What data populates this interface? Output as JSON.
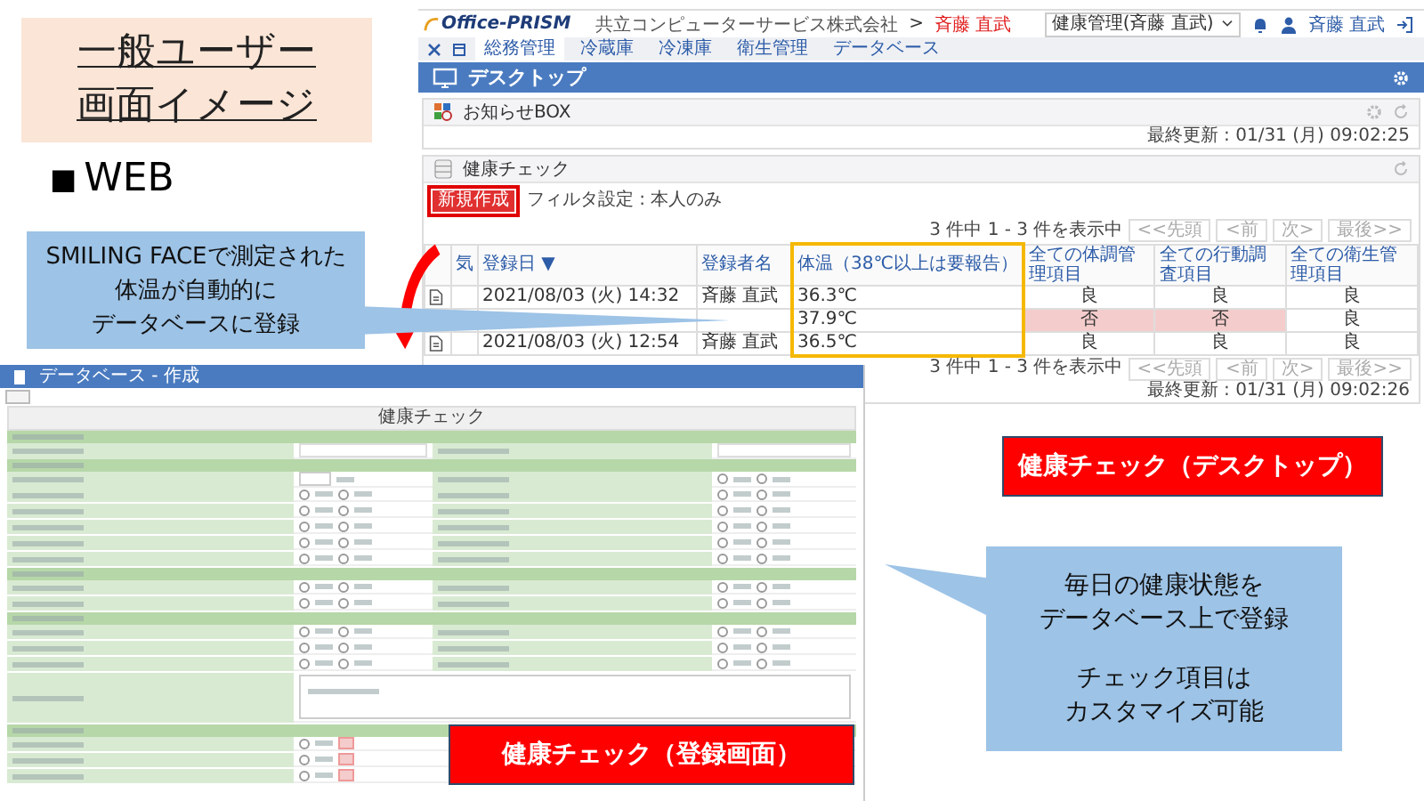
{
  "slide": {
    "title_lines": [
      "一般ユーザー",
      "画面イメージ"
    ],
    "bullet_glyph": "■",
    "bullet_text": "WEB",
    "callout_left": [
      "SMILING FACEで測定された",
      "体温が自動的に",
      "データベースに登録"
    ],
    "desktop_label": "健康チェック（デスクトップ）",
    "form_label": "健康チェック（登録画面）",
    "callout_right": [
      [
        "毎日の健康状態を",
        "データベース上で登録"
      ],
      [
        "チェック項目は",
        "カスタマイズ可能"
      ]
    ]
  },
  "desktop": {
    "logo": "Office-PRISM",
    "company": "共立コンピューターサービス株式会社",
    "breadcrumb_sep": ">",
    "breadcrumb_user": "斉藤 直武",
    "role_select": "健康管理(斉藤 直武)",
    "user_name": "斉藤 直武",
    "menu": [
      {
        "label": "総務管理",
        "selected": true
      },
      {
        "label": "冷蔵庫",
        "selected": false
      },
      {
        "label": "冷凍庫",
        "selected": false
      },
      {
        "label": "衛生管理",
        "selected": false
      },
      {
        "label": "データベース",
        "selected": false
      }
    ],
    "page_title": "デスクトップ",
    "notice_panel": {
      "title": "お知らせBOX",
      "updated": "最終更新 : 01/31 (月) 09:02:25"
    },
    "health_panel": {
      "title": "健康チェック",
      "new_button": "新規作成",
      "filter": "フィルタ設定 : 本人のみ",
      "count": "3 件中 1 - 3 件を表示中",
      "pager": [
        "<<先頭",
        "<前",
        "次>",
        "最後>>"
      ],
      "columns": [
        "気",
        "登録日 ▼",
        "登録者名",
        "体温（38℃以上は要報告）",
        "全ての体調管理項目",
        "全ての行動調査項目",
        "全ての衛生管理項目"
      ],
      "rows": [
        {
          "date": "2021/08/03 (火) 14:32",
          "name": "斉藤 直武",
          "temp": "36.3℃",
          "items": [
            {
              "text": "良",
              "alert": false
            },
            {
              "text": "良",
              "alert": false
            },
            {
              "text": "良",
              "alert": false
            }
          ]
        },
        {
          "temp": "37.9℃",
          "items": [
            {
              "text": "否",
              "alert": true
            },
            {
              "text": "否",
              "alert": true
            },
            {
              "text": "良",
              "alert": false
            }
          ]
        },
        {
          "date": "2021/08/03 (火) 12:54",
          "name": "斉藤 直武",
          "temp": "36.5℃",
          "items": [
            {
              "text": "良",
              "alert": false
            },
            {
              "text": "良",
              "alert": false
            },
            {
              "text": "良",
              "alert": false
            }
          ]
        }
      ],
      "count_bottom": "3 件中 1 - 3 件を表示中",
      "pager_bottom": [
        "<<先頭",
        "<前",
        "次>",
        "最後>>"
      ],
      "updated": "最終更新 : 01/31 (月) 09:02:26"
    }
  },
  "form": {
    "header": "データベース - 作成",
    "title": "健康チェック",
    "rows": [
      {
        "kind": "section"
      },
      {
        "kind": "inputs"
      },
      {
        "kind": "section"
      },
      {
        "kind": "temp_radios",
        "answered": false
      },
      {
        "kind": "radios",
        "answered": false
      },
      {
        "kind": "radios",
        "answered": false
      },
      {
        "kind": "radios",
        "answered": false
      },
      {
        "kind": "radios",
        "answered": false
      },
      {
        "kind": "radios",
        "answered": false
      },
      {
        "kind": "section"
      },
      {
        "kind": "radios",
        "answered": false
      },
      {
        "kind": "radios",
        "answered": false
      },
      {
        "kind": "section"
      },
      {
        "kind": "radios",
        "answered": false
      },
      {
        "kind": "radios",
        "answered": false
      },
      {
        "kind": "radios",
        "answered": false
      },
      {
        "kind": "memo"
      },
      {
        "kind": "section"
      },
      {
        "kind": "choice",
        "good_selected": false,
        "bad_selected": true
      },
      {
        "kind": "choice",
        "good_selected": false,
        "bad_selected": true
      },
      {
        "kind": "choice",
        "good_selected": false,
        "bad_selected": true
      }
    ]
  }
}
